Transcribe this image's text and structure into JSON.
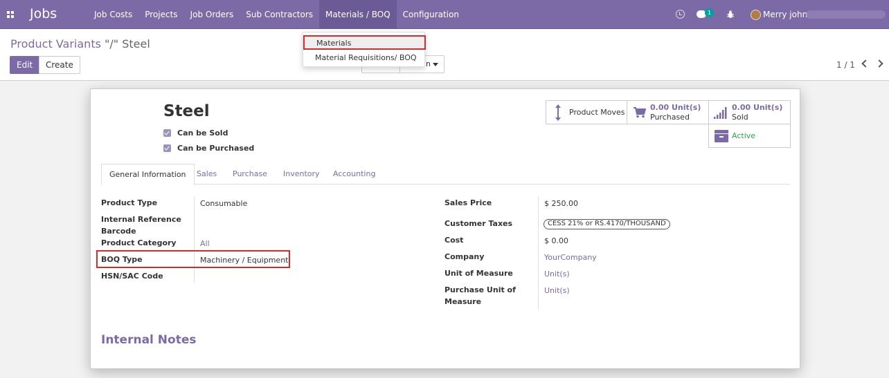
{
  "navbar": {
    "brand": "Jobs",
    "menu": [
      "Job Costs",
      "Projects",
      "Job Orders",
      "Sub Contractors",
      "Materials / BOQ",
      "Configuration"
    ],
    "active_menu": "Materials / BOQ",
    "chat_count": "1",
    "user_name": "Merry john",
    "icons": [
      "apps-icon",
      "clock-icon",
      "chat-icon",
      "bug-icon"
    ]
  },
  "dropdown": {
    "items": [
      "Materials",
      "Material Requisitions/ BOQ"
    ],
    "highlighted": "Materials"
  },
  "control_panel": {
    "breadcrumb_parent": "Product Variants",
    "breadcrumb_current": "\"/\" Steel",
    "edit_label": "Edit",
    "create_label": "Create",
    "action_partial": "n",
    "pager": "1 / 1"
  },
  "product": {
    "name": "Steel",
    "can_be_sold_label": "Can be Sold",
    "can_be_purchased_label": "Can be Purchased",
    "can_be_sold": true,
    "can_be_purchased": true
  },
  "smart_buttons": {
    "moves_label": "Product Moves",
    "purchased_value": "0.00 Unit(s)",
    "purchased_label": "Purchased",
    "sold_value": "0.00 Unit(s)",
    "sold_label": "Sold",
    "active_label": "Active"
  },
  "tabs": [
    "General Information",
    "Sales",
    "Purchase",
    "Inventory",
    "Accounting"
  ],
  "active_tab": "General Information",
  "left_fields": {
    "product_type_label": "Product Type",
    "product_type_value": "Consumable",
    "internal_ref_label": "Internal Reference",
    "barcode_label": "Barcode",
    "category_label": "Product Category",
    "category_value": "All",
    "boq_type_label": "BOQ Type",
    "boq_type_value": "Machinery / Equipment",
    "hsn_label": "HSN/SAC Code"
  },
  "right_fields": {
    "sales_price_label": "Sales Price",
    "sales_price_value": "$ 250.00",
    "customer_taxes_label": "Customer Taxes",
    "customer_taxes_value": "CESS 21% or RS.4170/THOUSAND",
    "cost_label": "Cost",
    "cost_value": "$ 0.00",
    "company_label": "Company",
    "company_value": "YourCompany",
    "uom_label": "Unit of Measure",
    "uom_value": "Unit(s)",
    "purchase_uom_label_1": "Purchase Unit of",
    "purchase_uom_label_2": "Measure",
    "purchase_uom_value": "Unit(s)"
  },
  "internal_notes_title": "Internal Notes",
  "colors": {
    "brand": "#7c6aa6",
    "highlight": "#d62b2b",
    "active_green": "#28a745"
  }
}
